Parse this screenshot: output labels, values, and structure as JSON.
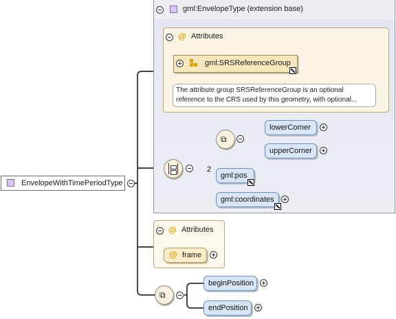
{
  "root": {
    "label": "EnvelopeWithTimePeriodType",
    "icon": "complex-type-icon"
  },
  "extension": {
    "title": "gml:EnvelopeType (extension base)",
    "attributes_title": "Attributes",
    "attribute_group": {
      "label": "gml:SRSReferenceGroup"
    },
    "tooltip": "The attribute group SRSReferenceGroup is an optional reference to the CRS used by this geometry, with optional...",
    "inner_sequence_elements": [
      "lowerCorner",
      "upperCorner"
    ],
    "choice_elements": [
      {
        "label": "gml:pos",
        "multiplicity": "2"
      },
      {
        "label": "gml:coordinates"
      }
    ]
  },
  "attributes": {
    "title": "Attributes",
    "items": [
      "frame"
    ]
  },
  "sequence_elements": [
    "beginPosition",
    "endPosition"
  ],
  "colors": {
    "panel_bg": "#eceef4",
    "attr_bg": "#fbf5e6",
    "element_bg": "#d9e6f7",
    "icon_purple": "#d6c7ec",
    "at_orange": "#e0a000"
  }
}
